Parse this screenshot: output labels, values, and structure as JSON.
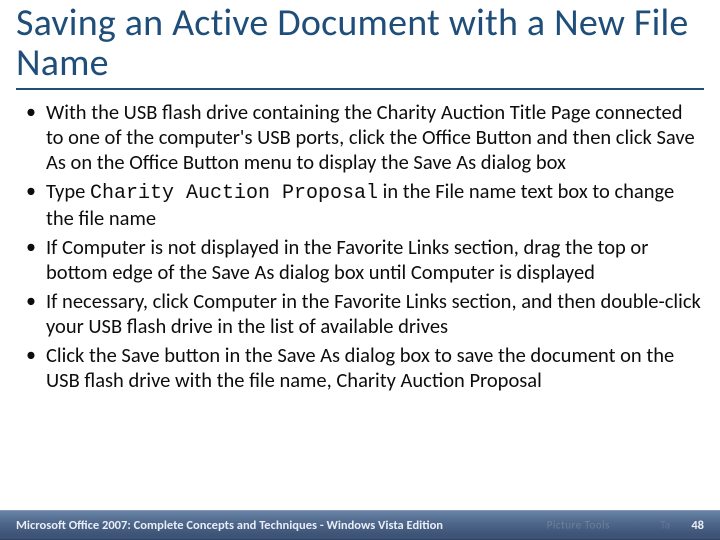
{
  "title": "Saving an Active Document with a New File Name",
  "bullets": [
    {
      "pre": "With the USB flash drive containing the Charity Auction Title Page connected to one of the computer's USB ports, click the Office Button and then click Save As on the Office Button menu to display the Save As dialog box"
    },
    {
      "pre": "Type ",
      "mono": "Charity Auction Proposal",
      "post": " in the File name text box to change the file name"
    },
    {
      "pre": "If Computer is not displayed in the Favorite Links section, drag the top or bottom edge of the Save As dialog box until Computer is displayed"
    },
    {
      "pre": "If necessary, click Computer in the Favorite Links section, and then double-click your USB flash drive in the list of available drives"
    },
    {
      "pre": "Click the Save button in the Save As dialog box to save the document on the USB flash drive with the file name, Charity Auction Proposal"
    }
  ],
  "footer": {
    "text": "Microsoft Office 2007: Complete Concepts and Techniques - Windows Vista Edition",
    "page": "48",
    "ghost1": "Picture Tools",
    "ghost2": "Ta"
  }
}
